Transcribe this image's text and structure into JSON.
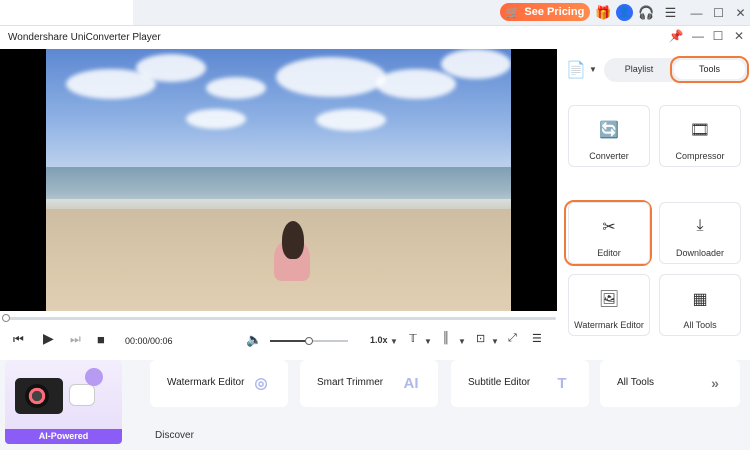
{
  "topbar": {
    "pricing_label": "See Pricing",
    "icons": [
      "cart-icon",
      "gift-icon",
      "user-avatar-icon",
      "headset-icon",
      "menu-icon",
      "minimize-icon",
      "maximize-icon",
      "close-icon"
    ]
  },
  "player": {
    "title": "Wondershare UniConverter Player",
    "time": "00:00/00:06",
    "speed": "1.0x",
    "volume_fraction": 0.5,
    "progress_fraction": 0.0
  },
  "panel": {
    "tabs": {
      "playlist": "Playlist",
      "tools": "Tools"
    },
    "selected_tab": "Tools",
    "tools": [
      {
        "label": "Converter",
        "icon": "converter-icon"
      },
      {
        "label": "Compressor",
        "icon": "compressor-icon"
      },
      {
        "label": "Editor",
        "icon": "editor-icon"
      },
      {
        "label": "Downloader",
        "icon": "downloader-icon"
      },
      {
        "label": "Watermark Editor",
        "icon": "watermark-editor-icon"
      },
      {
        "label": "All Tools",
        "icon": "all-tools-icon"
      }
    ],
    "highlighted_tool": "Editor"
  },
  "bottom": {
    "promo_label": "AI-Powered",
    "cards": [
      {
        "label": "Watermark Editor"
      },
      {
        "label": "Smart Trimmer"
      },
      {
        "label": "Subtitle Editor"
      },
      {
        "label": "All Tools"
      }
    ],
    "discover": "Discover"
  },
  "colors": {
    "accent": "#f07a3a",
    "pricing": "#ff6a3d",
    "brand_purple": "#8b5cf6",
    "avatar_blue": "#2f6bff"
  }
}
